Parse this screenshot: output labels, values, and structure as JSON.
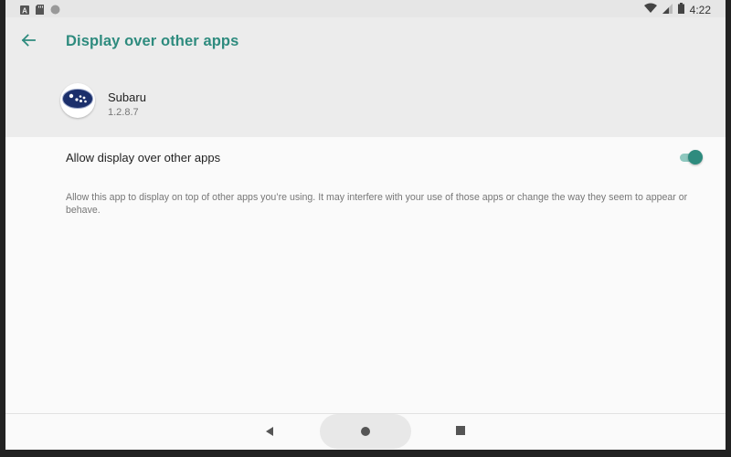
{
  "status_bar": {
    "time": "4:22",
    "left_icons": [
      "a-notification-icon",
      "sd-card-icon",
      "circle-notification-icon"
    ],
    "right_icons": [
      "wifi-icon",
      "signal-icon",
      "battery-icon"
    ]
  },
  "header": {
    "title": "Display over other apps",
    "back_icon": "arrow-back-icon"
  },
  "app": {
    "name": "Subaru",
    "version": "1.2.8.7",
    "icon": "subaru-logo-icon"
  },
  "setting": {
    "label": "Allow display over other apps",
    "enabled": true,
    "description": "Allow this app to display on top of other apps you’re using. It may interfere with your use of those apps or change the way they seem to appear or behave."
  },
  "colors": {
    "accent": "#2e8b7e",
    "accent_light": "#8fc8bf",
    "header_bg": "#ececec",
    "page_bg": "#fafafa"
  },
  "nav_bar": {
    "icons": [
      "nav-back-icon",
      "nav-home-icon",
      "nav-recents-icon"
    ]
  }
}
